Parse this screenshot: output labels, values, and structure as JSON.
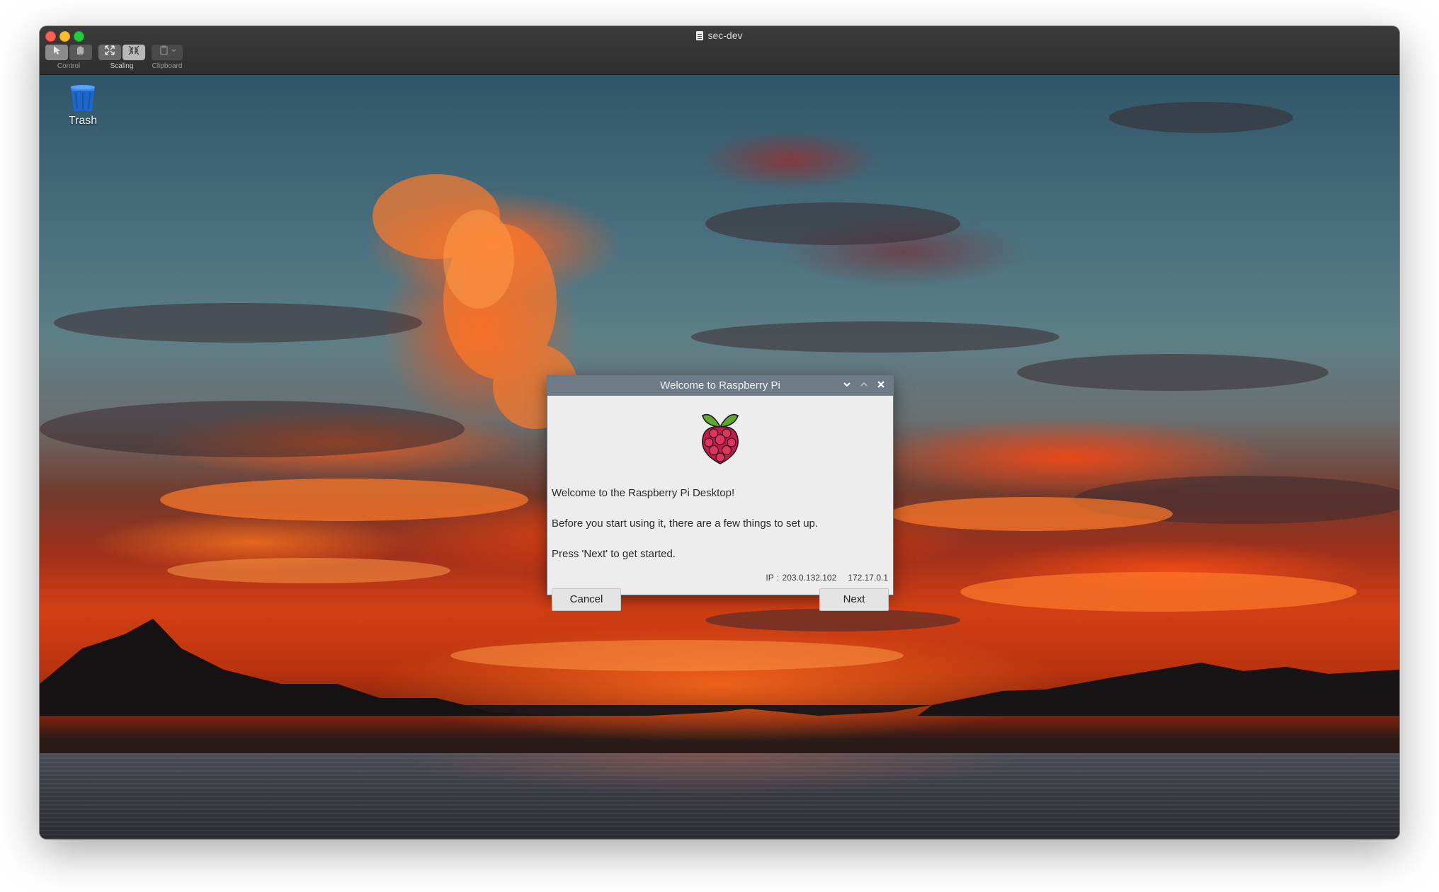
{
  "window": {
    "title": "sec-dev"
  },
  "toolbar": {
    "groups": [
      {
        "label": "Control"
      },
      {
        "label": "Scaling"
      },
      {
        "label": "Clipboard"
      }
    ]
  },
  "desktop": {
    "icons": [
      {
        "label": "Trash",
        "icon": "trash-icon"
      }
    ]
  },
  "dialog": {
    "title": "Welcome to Raspberry Pi",
    "logo": "raspberry-pi-logo",
    "welcome_text": "Welcome to the Raspberry Pi Desktop!",
    "setup_text": "Before you start using it, there are a few things to set up.",
    "press_text": "Press 'Next' to get started.",
    "ip_label": "IP : 203.0.132.102",
    "ip_secondary": "172.17.0.1",
    "cancel_label": "Cancel",
    "next_label": "Next",
    "accent_color": "#6e7b87"
  }
}
